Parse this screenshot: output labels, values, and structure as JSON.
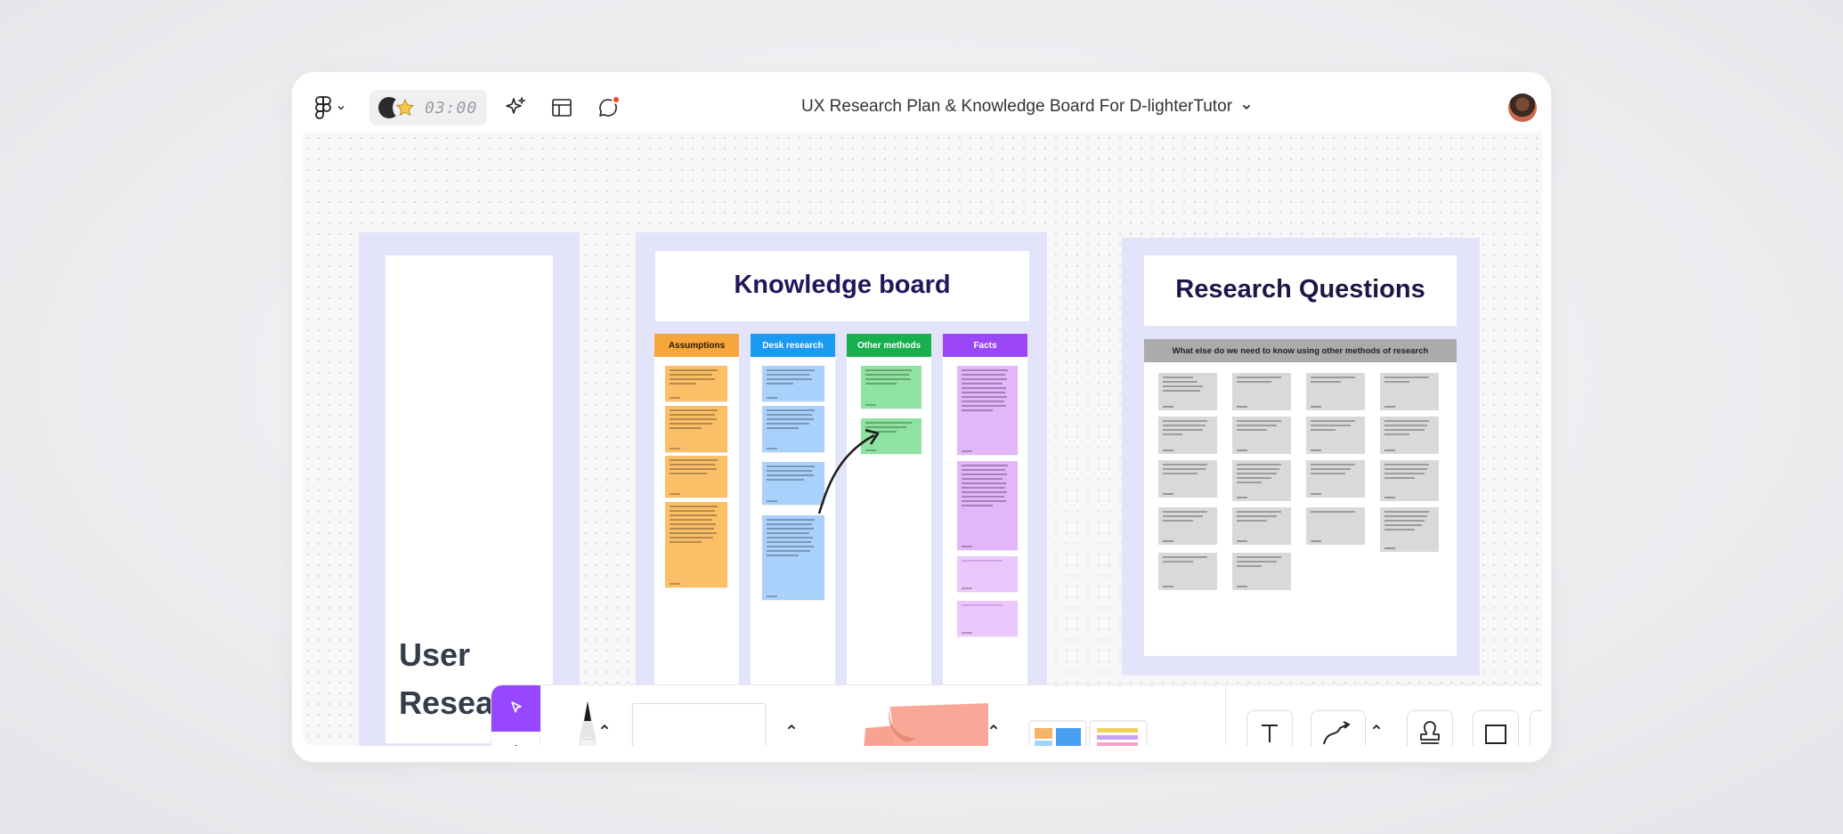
{
  "app": {
    "board_title": "UX Research Plan & Knowledge Board For D-lighterTutor",
    "timer": "03:00"
  },
  "icons": {
    "figma_menu": "figma-logo-icon",
    "ai": "sparkle-icon",
    "layout": "layout-icon",
    "comments": "comment-icon",
    "accent_purple": "#9747ff",
    "notif_red": "#f24822"
  },
  "sections": {
    "user_research": {
      "title_line1": "User",
      "title_line2": "Research"
    },
    "knowledge_board": {
      "title": "Knowledge board",
      "columns": [
        {
          "label": "Assumptions",
          "color": "#f7a63c"
        },
        {
          "label": "Desk research",
          "color": "#1a9af0"
        },
        {
          "label": "Other methods",
          "color": "#18b04e"
        },
        {
          "label": "Facts",
          "color": "#9b47f5"
        }
      ]
    },
    "research_questions": {
      "title": "Research Questions",
      "banner": "What else do we need to know using other methods of research"
    }
  },
  "toolbar": {
    "select_tool": "cursor-icon",
    "hand_tool": "hand-icon",
    "text_tool": "text-tool-icon",
    "connector_tool": "connector-icon",
    "stamp_tool": "stamp-icon",
    "section_tool": "section-icon"
  }
}
